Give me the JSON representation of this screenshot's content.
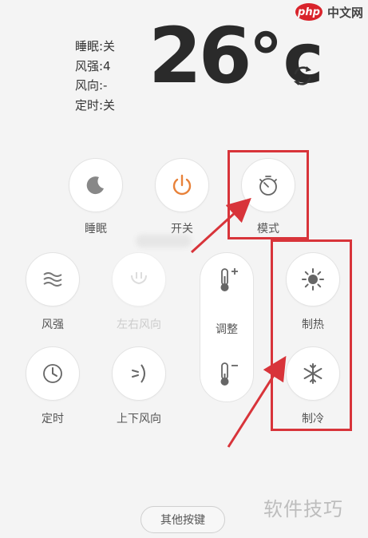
{
  "watermark_top": {
    "badge": "php",
    "text": "中文网"
  },
  "status": {
    "sleep": "睡眠:关",
    "fan_speed": "风强:4",
    "wind_direction": "风向:-",
    "timer": "定时:关"
  },
  "temperature": {
    "value": "26",
    "unit": "°c"
  },
  "buttons": {
    "sleep": "睡眠",
    "power": "开关",
    "mode": "模式",
    "fan_speed": "风强",
    "left_right_wind": "左右风向",
    "adjust": "调整",
    "heat": "制热",
    "timer": "定时",
    "up_down_wind": "上下风向",
    "cool": "制冷"
  },
  "other_keys": "其他按键",
  "watermark_bottom": "软件技巧",
  "colors": {
    "annotation_red": "#d8343a",
    "power_orange": "#e8823a"
  }
}
